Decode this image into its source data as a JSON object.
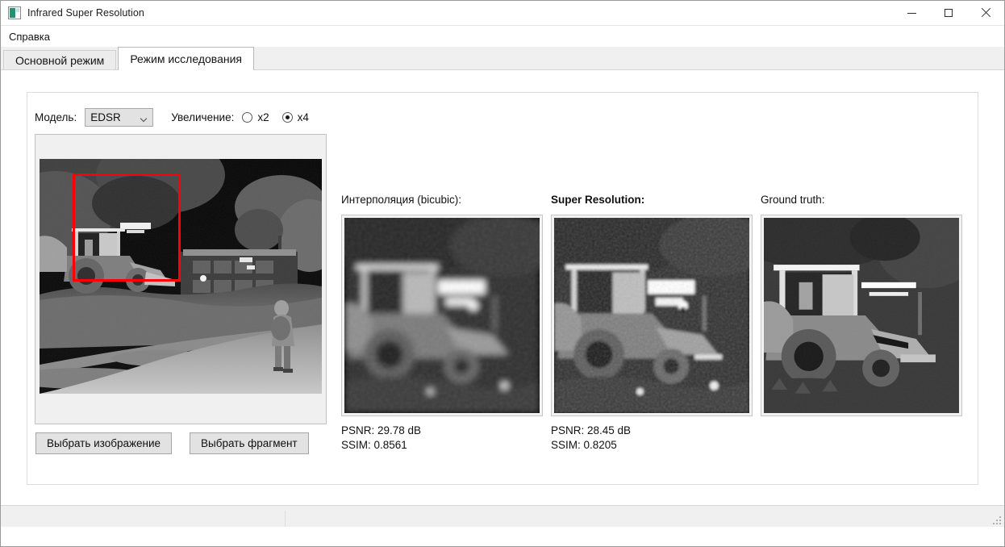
{
  "window": {
    "title": "Infrared Super Resolution",
    "icon": "image-frame-icon",
    "controls": {
      "minimize": "minimize-icon",
      "maximize": "maximize-icon",
      "close": "close-icon"
    }
  },
  "menubar": {
    "items": [
      {
        "label": "Справка"
      }
    ]
  },
  "tabs": [
    {
      "label": "Основной режим",
      "active": false
    },
    {
      "label": "Режим исследования",
      "active": true
    }
  ],
  "controls": {
    "model_label": "Модель:",
    "model_value": "EDSR",
    "model_options": [
      "EDSR"
    ],
    "scale_label": "Увеличение:",
    "scale_options": [
      {
        "label": "x2",
        "checked": false
      },
      {
        "label": "x4",
        "checked": true
      }
    ]
  },
  "buttons": {
    "choose_image": "Выбрать изображение",
    "choose_fragment": "Выбрать фрагмент"
  },
  "preview": {
    "name": "source-image-preview",
    "selection_color": "#fe0000",
    "description": "Инфракрасное изображение: экскаватор-погрузчик, здание, деревья, дорога и пешеход"
  },
  "results": [
    {
      "title": "Интерполяция (bicubic):",
      "bold": false,
      "psnr": "PSNR: 29.78 dB",
      "ssim": "SSIM: 0.8561",
      "render": "blurry"
    },
    {
      "title": "Super Resolution:",
      "bold": true,
      "psnr": "PSNR: 28.45 dB",
      "ssim": "SSIM: 0.8205",
      "render": "sharpened"
    },
    {
      "title": "Ground truth:",
      "bold": false,
      "psnr": "",
      "ssim": "",
      "render": "sharp"
    }
  ],
  "statusbar": {
    "text": "",
    "grip": "resize-grip-icon"
  }
}
